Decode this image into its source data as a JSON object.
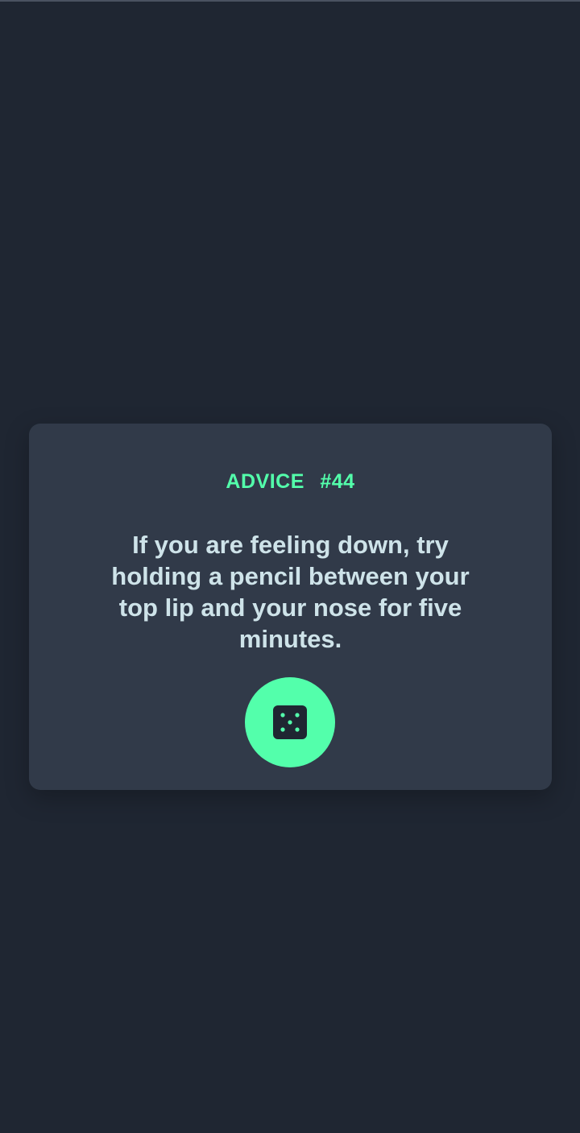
{
  "advice": {
    "label": "ADVICE",
    "number": "#44",
    "text": "If you are feeling down, try holding a pencil between your top lip and your nose for five minutes."
  },
  "button": {
    "icon": "dice-icon"
  },
  "colors": {
    "background": "#1f2632",
    "card": "#313a49",
    "accent": "#53ffab",
    "text": "#cee3e9"
  }
}
